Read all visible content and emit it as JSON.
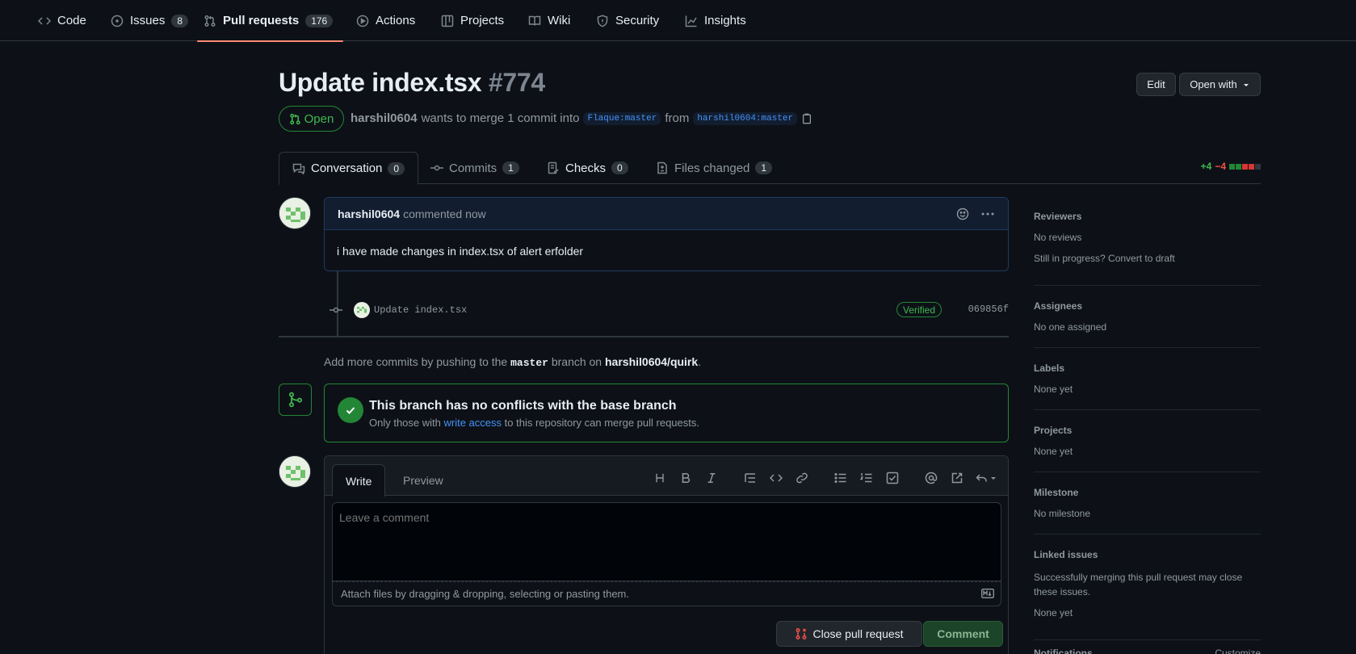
{
  "nav": {
    "items": [
      {
        "label": "Code",
        "icon": "code-icon"
      },
      {
        "label": "Issues",
        "count": "8",
        "icon": "issue-opened-icon"
      },
      {
        "label": "Pull requests",
        "count": "176",
        "icon": "git-pull-request-icon"
      },
      {
        "label": "Actions",
        "icon": "play-icon"
      },
      {
        "label": "Projects",
        "icon": "table-icon"
      },
      {
        "label": "Wiki",
        "icon": "book-icon"
      },
      {
        "label": "Security",
        "icon": "shield-icon"
      },
      {
        "label": "Insights",
        "icon": "graph-icon"
      }
    ]
  },
  "pr": {
    "title": "Update index.tsx",
    "number": "#774",
    "state": "Open",
    "author": "harshil0604",
    "merge_text": "wants to merge 1 commit into",
    "base_branch": "Flaque:master",
    "from_text": "from",
    "head_branch": "harshil0604:master"
  },
  "header_buttons": {
    "edit": "Edit",
    "open_with": "Open with"
  },
  "tabs": [
    {
      "label": "Conversation",
      "count": "0"
    },
    {
      "label": "Commits",
      "count": "1"
    },
    {
      "label": "Checks",
      "count": "0"
    },
    {
      "label": "Files changed",
      "count": "1"
    }
  ],
  "diffstat": {
    "added": "+4",
    "removed": "−4"
  },
  "comment": {
    "author": "harshil0604",
    "action": "commented now",
    "body": "i have made changes in index.tsx of alert erfolder"
  },
  "commit": {
    "message": "Update index.tsx",
    "badge": "Verified",
    "sha": "069856f"
  },
  "hint": {
    "prefix": "Add more commits by pushing to the",
    "branch": "master",
    "middle": "branch on",
    "repo": "harshil0604/quirk",
    "suffix": "."
  },
  "merge": {
    "title": "This branch has no conflicts with the base branch",
    "sub_prefix": "Only those with",
    "link": "write access",
    "sub_suffix": "to this repository can merge pull requests."
  },
  "editor": {
    "tab_write": "Write",
    "tab_preview": "Preview",
    "placeholder": "Leave a comment",
    "attach": "Attach files by dragging & dropping, selecting or pasting them.",
    "close_button": "Close pull request",
    "comment_button": "Comment"
  },
  "sidebar": {
    "reviewers_title": "Reviewers",
    "reviewers_value": "No reviews",
    "reviewers_draft": "Still in progress? Convert to draft",
    "assignees_title": "Assignees",
    "assignees_value": "No one assigned",
    "labels_title": "Labels",
    "labels_value": "None yet",
    "projects_title": "Projects",
    "projects_value": "None yet",
    "milestone_title": "Milestone",
    "milestone_value": "No milestone",
    "linked_title": "Linked issues",
    "linked_desc": "Successfully merging this pull request may close these issues.",
    "linked_value": "None yet",
    "notifications_title": "Notifications",
    "notifications_action": "Customize"
  },
  "colors": {
    "accent": "#4493f8",
    "success": "#3fb950",
    "danger": "#f85149",
    "nav_underline": "#fd8c73"
  }
}
